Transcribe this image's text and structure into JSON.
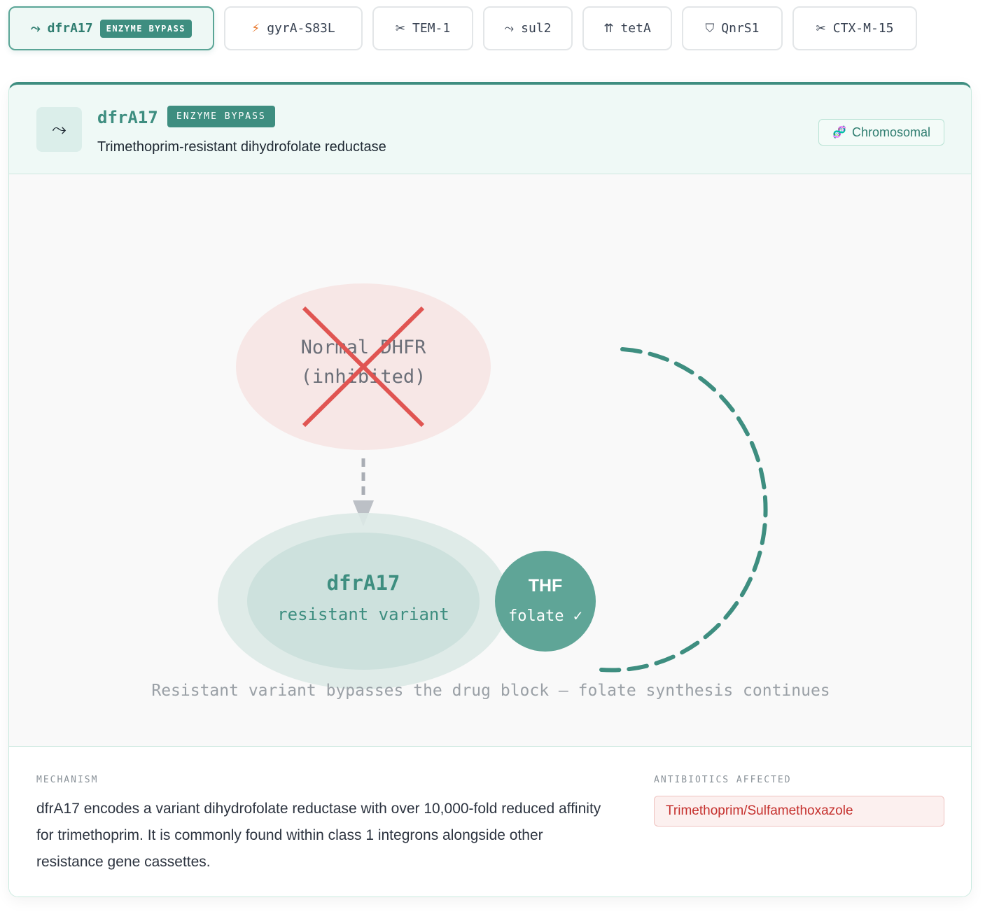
{
  "tabs": [
    {
      "icon": "⤳",
      "icon_name": "bypass-arrow-icon",
      "label": "dfrA17",
      "badge": "ENZYME BYPASS",
      "active": true
    },
    {
      "icon": "⚡",
      "icon_name": "lightning-icon",
      "label": "gyrA-S83L",
      "active": false
    },
    {
      "icon": "✂",
      "icon_name": "scissors-icon",
      "label": "TEM-1",
      "active": false
    },
    {
      "icon": "⤳",
      "icon_name": "bypass-arrow-icon",
      "label": "sul2",
      "active": false
    },
    {
      "icon": "⇈",
      "icon_name": "efflux-arrows-icon",
      "label": "tetA",
      "active": false
    },
    {
      "icon": "⛉",
      "icon_name": "shield-icon",
      "label": "QnrS1",
      "active": false
    },
    {
      "icon": "✂",
      "icon_name": "scissors-icon",
      "label": "CTX-M-15",
      "active": false
    }
  ],
  "gene": {
    "icon": "⤳",
    "icon_name": "bypass-arrow-icon",
    "name": "dfrA17",
    "badge": "ENZYME BYPASS",
    "subtitle": "Trimethoprim-resistant dihydrofolate reductase",
    "location": "Chromosomal",
    "location_icon": "🧬",
    "location_icon_name": "dna-icon"
  },
  "diagram": {
    "inhibited_line1": "Normal DHFR",
    "inhibited_line2": "(inhibited)",
    "variant_name": "dfrA17",
    "variant_label": "resistant variant",
    "product_name": "THF",
    "product_label": "folate ✓",
    "caption": "Resistant variant bypasses the drug block — folate synthesis continues"
  },
  "details": {
    "mechanism_label": "MECHANISM",
    "mechanism_text": "dfrA17 encodes a variant dihydrofolate reductase with over 10,000-fold reduced affinity for trimethoprim. It is commonly found within class 1 integrons alongside other resistance gene cassettes.",
    "antibiotics_label": "ANTIBIOTICS AFFECTED",
    "antibiotics": [
      "Trimethoprim/Sulfamethoxazole"
    ]
  },
  "colors": {
    "accent": "#3e8e80",
    "danger": "#e05552",
    "warning": "#e8782e"
  }
}
